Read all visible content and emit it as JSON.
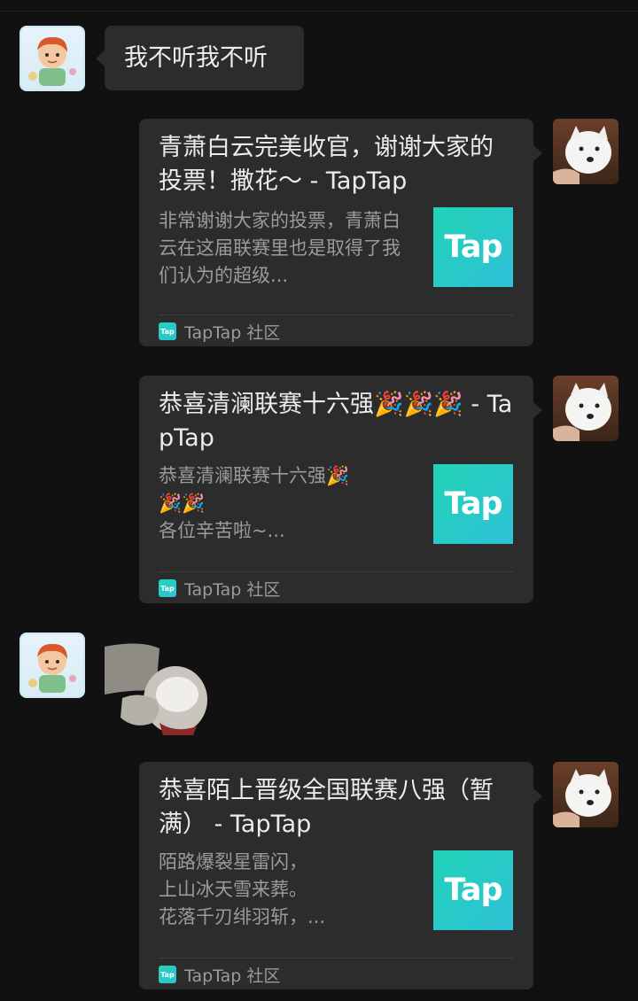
{
  "messages": [
    {
      "type": "text",
      "side": "left",
      "avatar": "boy-avatar",
      "text": "我不听我不听"
    },
    {
      "type": "link_card",
      "side": "right",
      "avatar": "dog-avatar",
      "title": "青萧白云完美收官，谢谢大家的投票！撒花～ - TapTap",
      "description": "非常谢谢大家的投票，青萧白云在这届联赛里也是取得了我们认为的超级...",
      "thumb_text": "Tap",
      "source": "TapTap 社区"
    },
    {
      "type": "link_card",
      "side": "right",
      "avatar": "dog-avatar",
      "title": "恭喜清澜联赛十六强🎉🎉🎉 - TapTap",
      "description_lines": [
        "恭喜清澜联赛十六强🎉",
        "🎉🎉",
        "各位辛苦啦~..."
      ],
      "thumb_text": "Tap",
      "source": "TapTap 社区"
    },
    {
      "type": "sticker",
      "side": "left",
      "avatar": "boy-avatar",
      "sticker": "hand-squeezing-sticker"
    },
    {
      "type": "link_card",
      "side": "right",
      "avatar": "dog-avatar",
      "title": "恭喜陌上晋级全国联赛八强（暂满） - TapTap",
      "description_lines": [
        "陌路爆裂星雷闪，",
        "上山冰天雪来葬。",
        "花落千刃绯羽斩，..."
      ],
      "thumb_text": "Tap",
      "source": "TapTap 社区"
    }
  ],
  "colors": {
    "background": "#111111",
    "bubble": "#2c2c2c",
    "taptap_accent": "#22d3b6"
  },
  "icons": [
    "boy-avatar",
    "dog-avatar",
    "taptap-icon",
    "hand-squeezing-sticker"
  ]
}
